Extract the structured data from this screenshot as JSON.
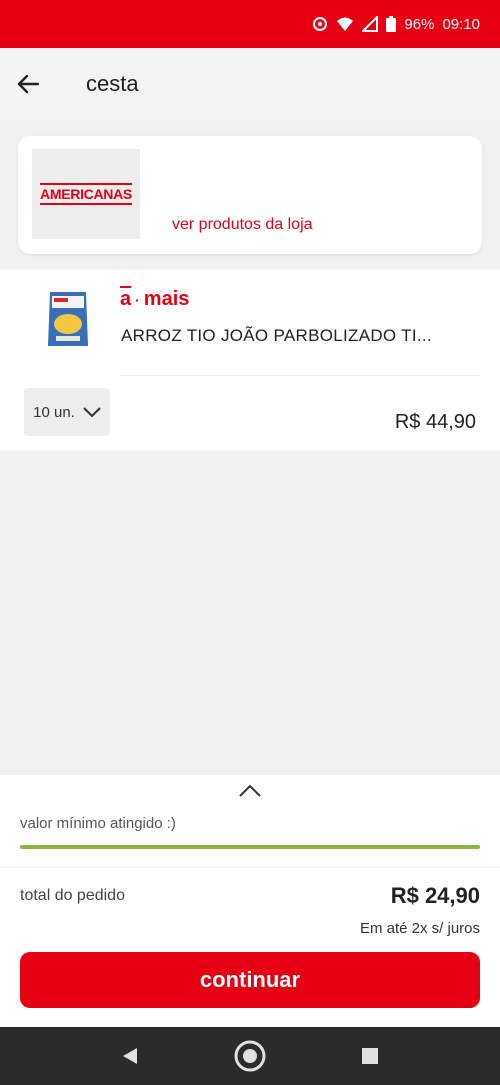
{
  "status_bar": {
    "battery": "96%",
    "time": "09:10"
  },
  "app_bar": {
    "title": "cesta",
    "back_icon": "arrow-left-icon"
  },
  "store": {
    "logo_text": "AMERICANAS",
    "link_label": "ver produtos da loja",
    "accent_color": "#e60014"
  },
  "product": {
    "badge_letter": "a",
    "badge_word": "mais",
    "name": "ARROZ TIO JOÃO PARBOLIZADO TI...",
    "quantity": "10 un.",
    "price": "R$ 44,90"
  },
  "summary": {
    "min_message": "valor mínimo atingido :)",
    "progress": 1.0,
    "progress_color": "#8cb545",
    "total_label": "total do pedido",
    "total_value": "R$ 24,90",
    "installments": "Em até 2x s/ juros",
    "continue_label": "continuar"
  },
  "nav": {
    "icons": [
      "back-triangle-icon",
      "home-circle-icon",
      "recents-square-icon"
    ]
  }
}
